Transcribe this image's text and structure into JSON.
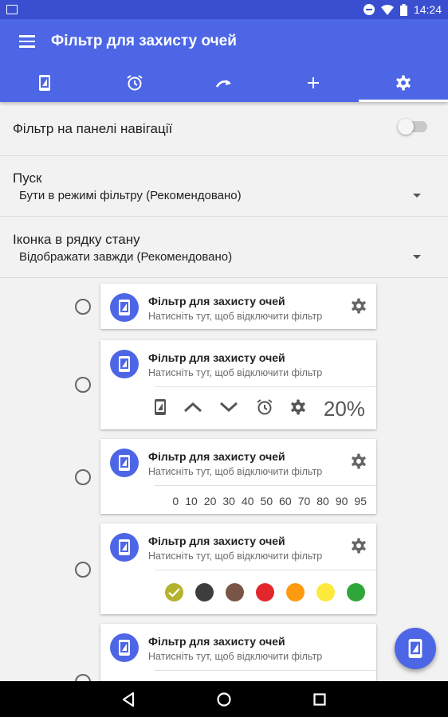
{
  "status_bar": {
    "time": "14:24"
  },
  "app_bar": {
    "title": "Фільтр для захисту очей",
    "tabs": [
      {
        "icon": "phone-filter-icon",
        "active": false
      },
      {
        "icon": "alarm-icon",
        "active": false
      },
      {
        "icon": "redo-icon",
        "active": false
      },
      {
        "icon": "plus-icon",
        "active": false
      },
      {
        "icon": "gear-icon",
        "active": true
      }
    ]
  },
  "settings": {
    "nav_filter": {
      "label": "Фільтр на панелі навігації",
      "enabled": false
    },
    "start": {
      "label": "Пуск",
      "value": "Бути в режимі фільтру (Рекомендовано)"
    },
    "status_icon": {
      "label": "Іконка в рядку стану",
      "value": "Відображати завжди (Рекомендовано)"
    }
  },
  "notification_styles": [
    {
      "title": "Фільтр для захисту очей",
      "subtitle": "Натисніть тут, щоб відключити фільтр"
    },
    {
      "title": "Фільтр для захисту очей",
      "subtitle": "Натисніть тут, щоб відключити фільтр",
      "percent": "20%"
    },
    {
      "title": "Фільтр для захисту очей",
      "subtitle": "Натисніть тут, щоб відключити фільтр",
      "levels": [
        "0",
        "10",
        "20",
        "30",
        "40",
        "50",
        "60",
        "70",
        "80",
        "90",
        "95"
      ]
    },
    {
      "title": "Фільтр для захисту очей",
      "subtitle": "Натисніть тут, щоб відключити фільтр",
      "colors": [
        "#b5b22e",
        "#3d3d3d",
        "#795548",
        "#e3262b",
        "#fd9a0f",
        "#fde93b",
        "#2fa63a"
      ],
      "selected_color": "#b5b22e"
    },
    {
      "title": "Фільтр для захисту очей",
      "subtitle": "Натисніть тут, щоб відключити фільтр"
    }
  ],
  "colors": {
    "primary": "#4d66e6",
    "status_bar": "#3a4fcf"
  }
}
